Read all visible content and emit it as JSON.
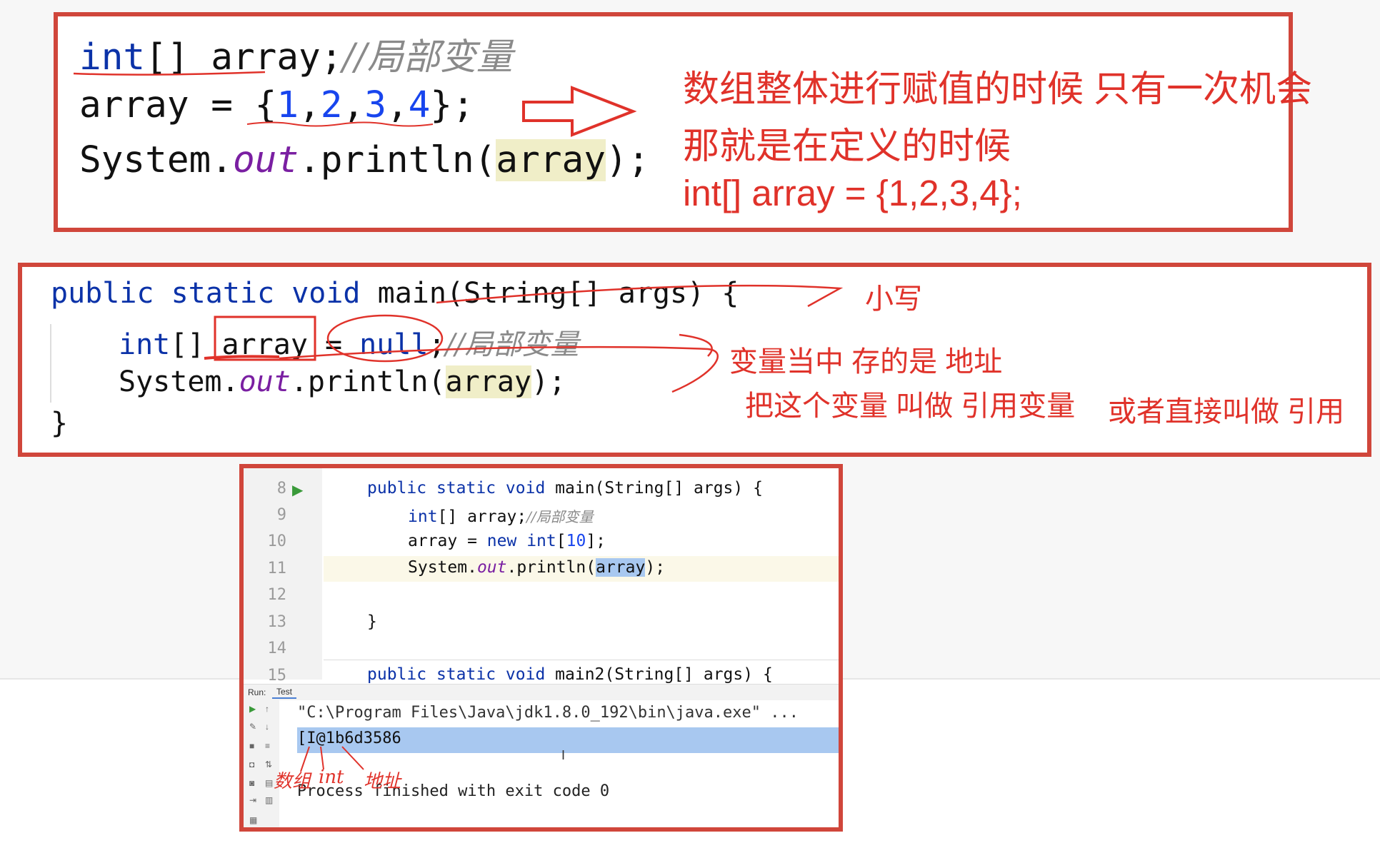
{
  "panel1": {
    "line1": {
      "kw": "int",
      "rest": "[] array;",
      "comment": "//局部变量"
    },
    "line2": {
      "start": "array = {",
      "n1": "1",
      "n2": "2",
      "n3": "3",
      "n4": "4",
      "end": "};"
    },
    "line3": {
      "a": "System.",
      "out": "out",
      "b": ".println(",
      "arg": "array",
      "c": ");"
    },
    "notes": [
      "数组整体进行赋值的时候 只有一次机会",
      "那就是在定义的时候",
      "int[] array = {1,2,3,4};"
    ]
  },
  "panel2": {
    "line1": {
      "kw1": "public",
      "kw2": "static",
      "kw3": "void",
      "rest": "main(String[] args) {"
    },
    "line2": {
      "kw": "int",
      "mid": "[] ",
      "var": "array",
      "eq": " = ",
      "null": "null",
      "semi": ";",
      "comment": "//局部变量"
    },
    "line3": {
      "a": "System.",
      "out": "out",
      "b": ".println(",
      "arg": "array",
      "c": ");"
    },
    "line4": "}",
    "notes": {
      "lower": "小写",
      "stores": "变量当中 存的是 地址",
      "called": "把这个变量 叫做  引用变量",
      "direct": "或者直接叫做  引用"
    }
  },
  "ide": {
    "line_numbers": [
      "8",
      "9",
      "10",
      "11",
      "12",
      "13",
      "14",
      "15"
    ],
    "code": {
      "l8": {
        "kw1": "public",
        "kw2": "static",
        "kw3": "void",
        "rest": "main(String[] args) {"
      },
      "l9": {
        "kw": "int",
        "rest": "[] array;",
        "comment": "//局部变量"
      },
      "l10": {
        "var": "array",
        "mid": " = ",
        "kw": "new",
        "kw2": "int",
        "open": "[",
        "num": "10",
        "close": "];"
      },
      "l11": {
        "a": "System.",
        "out": "out",
        "b": ".println(",
        "arg": "array",
        "c": ");"
      },
      "l13": "}",
      "l15": {
        "kw1": "public",
        "kw2": "static",
        "kw3": "void",
        "rest": "main2(String[] args) {"
      }
    },
    "run_label": "Run:",
    "run_tab": "Test",
    "console": {
      "cmd": "\"C:\\Program Files\\Java\\jdk1.8.0_192\\bin\\java.exe\" ...",
      "output": "[I@1b6d3586",
      "finished": "Process finished with exit code 0"
    },
    "annotations": {
      "array": "数组",
      "int": "int",
      "address": "地址"
    },
    "colors": {
      "keyword": "#0b32a8",
      "number": "#1845ee",
      "static_field": "#7a1fa2",
      "annotation": "#e0322a",
      "selection": "#a8c8f0"
    }
  }
}
